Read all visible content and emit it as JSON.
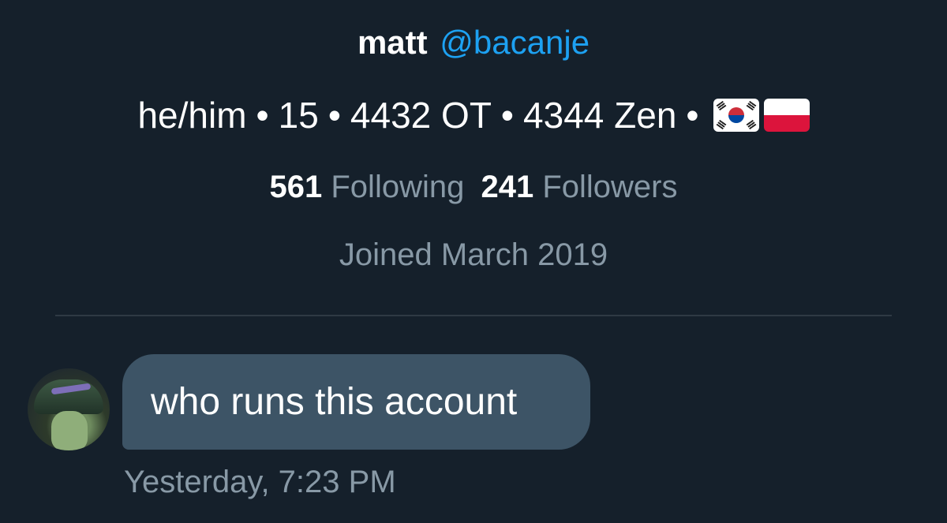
{
  "profile": {
    "display_name": "matt",
    "handle": "@bacanje",
    "bio": {
      "pronouns": "he/him",
      "separator": "•",
      "age": "15",
      "ot": "4432 OT",
      "zen": "4344 Zen",
      "flags": [
        "south-korea-flag",
        "poland-flag"
      ]
    },
    "following_count": "561",
    "following_label": "Following",
    "followers_count": "241",
    "followers_label": "Followers",
    "joined": "Joined March 2019"
  },
  "message": {
    "text": "who runs this account",
    "timestamp": "Yesterday, 7:23 PM"
  },
  "colors": {
    "background": "#15202b",
    "accent": "#1da1f2",
    "muted": "#8899a6",
    "bubble": "#3d5466"
  }
}
